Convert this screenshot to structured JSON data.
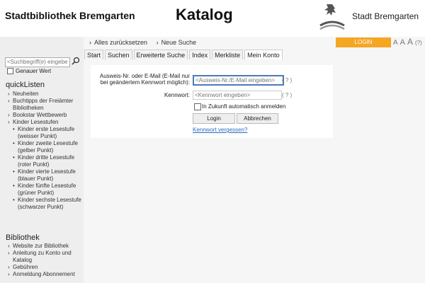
{
  "header": {
    "brand": "Stadtbibliothek Bremgarten",
    "title": "Katalog",
    "city": "Stadt Bremgarten"
  },
  "breadcrumbs": [
    "Alles zurücksetzen",
    "Neue Suche"
  ],
  "login_button": "LOGIN",
  "font_size": {
    "a1": "A",
    "a2": "A",
    "a3": "A",
    "help": "(?)"
  },
  "tabs": [
    {
      "label": "Start"
    },
    {
      "label": "Suchen"
    },
    {
      "label": "Erweiterte Suche"
    },
    {
      "label": "Index"
    },
    {
      "label": "Merkliste"
    },
    {
      "label": "Mein Konto"
    }
  ],
  "form": {
    "id_label_1": "Ausweis-Nr. oder E-Mail (E-Mail nur",
    "id_label_2": "bei geändertem Kennwort möglich):",
    "id_placeholder": "<Ausweis-Nr./E-Mail eingeben>",
    "password_label": "Kennwort:",
    "password_placeholder": "<Kennwort eingeben>",
    "help": "( ? )",
    "remember": "In Zukunft automatisch anmelden",
    "login": "Login",
    "cancel": "Abbrechen",
    "forgot": "Kennwort vergessen?"
  },
  "sidebar": {
    "search_placeholder": "<Suchbegriff(e) eingeben>",
    "exact_label": "Genauer Wert",
    "quicklists_title": "quickListen",
    "quicklists": [
      {
        "label": "Neuheiten",
        "sub": false
      },
      {
        "label": "Buchtipps der Freiämter Bibliotheken",
        "sub": false
      },
      {
        "label": "Bookstar Wettbewerb",
        "sub": false
      },
      {
        "label": "Kinder Lesestufen",
        "sub": false
      },
      {
        "label": "Kinder erste Lesestufe (weisser Punkt)",
        "sub": true
      },
      {
        "label": "Kinder zweite Lesestufe (gelber Punkt)",
        "sub": true
      },
      {
        "label": "Kinder dritte Lesestufe (roter Punkt)",
        "sub": true
      },
      {
        "label": "Kinder vierte Lesestufe (blauer Punkt)",
        "sub": true
      },
      {
        "label": "Kinder fünfte Lesestufe (grüner Punkt)",
        "sub": true
      },
      {
        "label": "Kinder sechste Lesestufe (schwarzer Punkt)",
        "sub": true
      }
    ],
    "library_title": "Bibliothek",
    "library": [
      {
        "label": "Website zur Bibliothek"
      },
      {
        "label": "Anleitung zu Konto und Katalog"
      },
      {
        "label": "Gebühren"
      },
      {
        "label": "Anmeldung Abonnement"
      }
    ]
  },
  "colors": {
    "accent": "#f5a623",
    "link": "#2a6cbf",
    "focus": "#4a7bb7"
  }
}
